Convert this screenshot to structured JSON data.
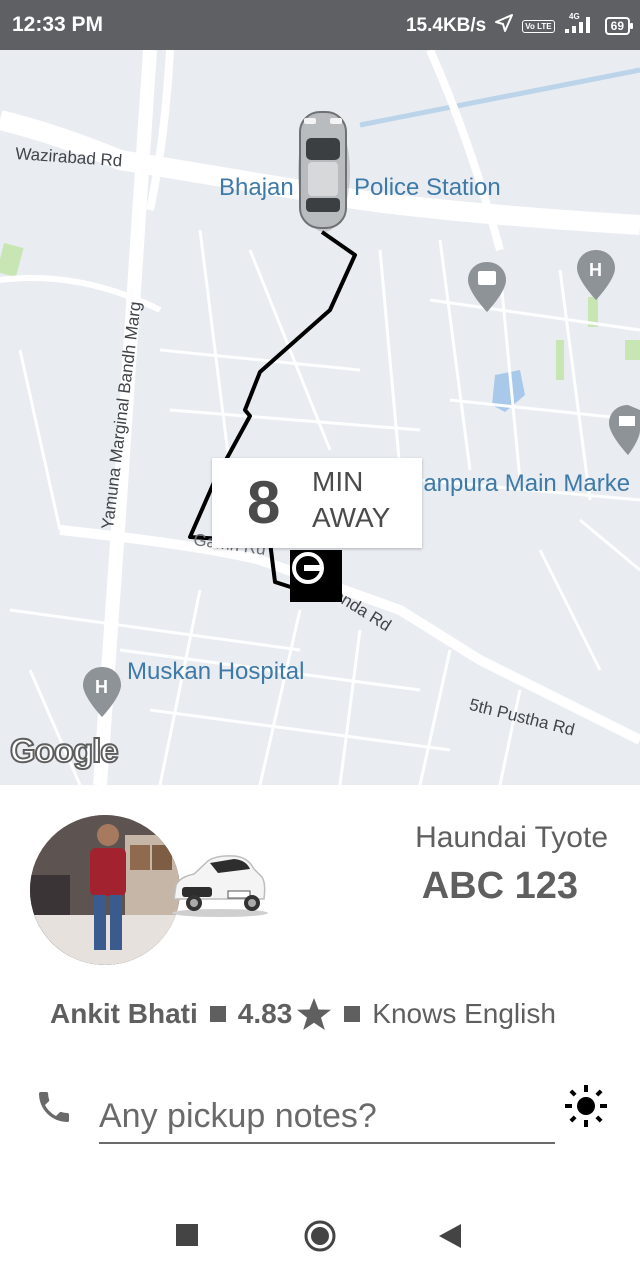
{
  "status_bar": {
    "time": "12:33 PM",
    "network_speed": "15.4KB/s",
    "network_type": "4G",
    "volte_label": "Vo LTE",
    "battery": "69"
  },
  "map": {
    "road_labels": {
      "wazirabad": "Wazirabad Rd",
      "yamuna": "Yamuna Marginal Bandh Marg",
      "gamri": "Gamri Rd",
      "gonda": "onda Rd",
      "pustha": "5th Pustha Rd"
    },
    "poi_labels": {
      "bhajan": "Bhajan",
      "police": "Police Station",
      "market": "janpura Main Marke",
      "hospital": "Muskan Hospital"
    },
    "google_logo": "Google",
    "eta": {
      "minutes": "8",
      "unit_line1": "MIN",
      "unit_line2": "AWAY"
    }
  },
  "driver_panel": {
    "car_model": "Haundai Tyote",
    "plate": "ABC 123",
    "driver_name": "Ankit Bhati",
    "rating": "4.83",
    "language": "Knows English",
    "notes_placeholder": "Any pickup notes?"
  },
  "icons": {
    "phone": "phone-icon",
    "brightness": "brightness-icon",
    "star": "star-icon",
    "car": "car-icon",
    "uber_pin": "uber-logo-icon",
    "nav_recents": "square-icon",
    "nav_home": "circle-icon",
    "nav_back": "triangle-icon"
  },
  "colors": {
    "status_bar": "#5f6063",
    "map_background": "#e9ecf1",
    "poi_text": "#3d7aa8",
    "route": "#000000",
    "panel_text": "#5f5f5f"
  }
}
